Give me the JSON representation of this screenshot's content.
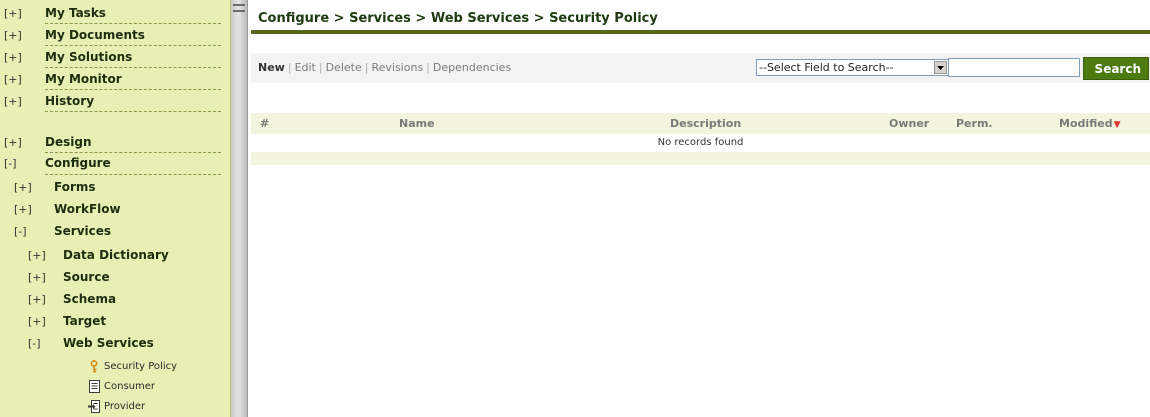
{
  "sidebar": {
    "items": [
      {
        "toggle": "[+]",
        "label": "My Tasks"
      },
      {
        "toggle": "[+]",
        "label": "My Documents"
      },
      {
        "toggle": "[+]",
        "label": "My Solutions"
      },
      {
        "toggle": "[+]",
        "label": "My Monitor"
      },
      {
        "toggle": "[+]",
        "label": "History"
      },
      {
        "toggle": "[+]",
        "label": "Design"
      },
      {
        "toggle": "[-]",
        "label": "Configure"
      },
      {
        "toggle": "[+]",
        "label": "Forms"
      },
      {
        "toggle": "[+]",
        "label": "WorkFlow"
      },
      {
        "toggle": "[-]",
        "label": "Services"
      },
      {
        "toggle": "[+]",
        "label": "Data Dictionary"
      },
      {
        "toggle": "[+]",
        "label": "Source"
      },
      {
        "toggle": "[+]",
        "label": "Schema"
      },
      {
        "toggle": "[+]",
        "label": "Target"
      },
      {
        "toggle": "[-]",
        "label": "Web Services"
      }
    ],
    "leaves": [
      {
        "icon": "key-icon",
        "label": "Security Policy"
      },
      {
        "icon": "document-icon",
        "label": "Consumer"
      },
      {
        "icon": "provider-icon",
        "label": "Provider"
      }
    ]
  },
  "main": {
    "breadcrumb": "Configure > Services > Web Services > Security Policy",
    "actions": {
      "new": "New",
      "edit": "Edit",
      "delete": "Delete",
      "revisions": "Revisions",
      "dependencies": "Dependencies",
      "separator": "|"
    },
    "search": {
      "select_value": "--Select Field to Search--",
      "input_value": "",
      "button_label": "Search"
    },
    "table": {
      "columns": {
        "num": "#",
        "name": "Name",
        "description": "Description",
        "owner": "Owner",
        "perm": "Perm.",
        "modified": "Modified"
      },
      "sort_indicator": "▼",
      "empty_message": "No records found"
    }
  },
  "colors": {
    "sidebar_bg": "#e8efb5",
    "title_rule": "#55681b",
    "search_button": "#4e7a12",
    "header_band": "#f2f4dd",
    "sort_arrow": "#e0332b"
  }
}
